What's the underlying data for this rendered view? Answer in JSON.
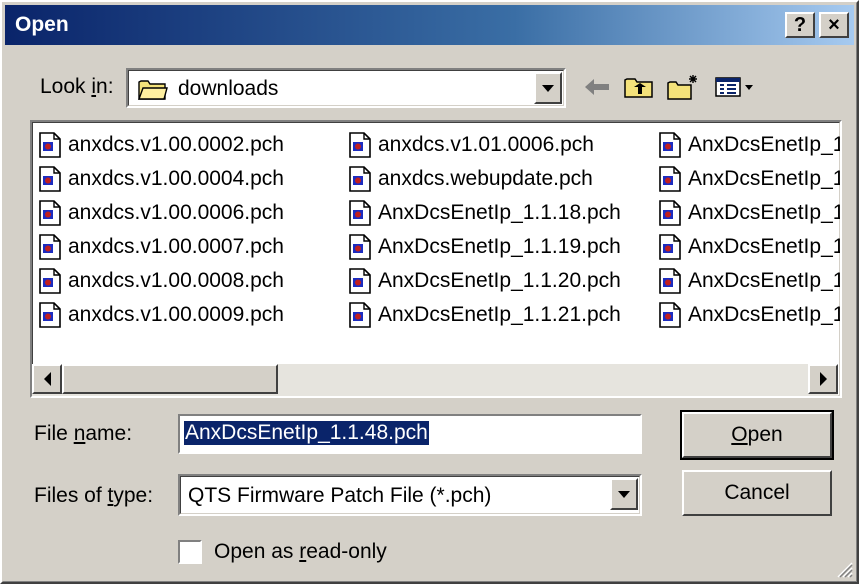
{
  "window": {
    "title": "Open",
    "help_button": "?",
    "close_button": "×"
  },
  "lookin": {
    "label_pre": "Look ",
    "label_key": "i",
    "label_post": "n:",
    "value": "downloads",
    "folder_icon": "folder-icon"
  },
  "toolbar": {
    "back_icon": "back-arrow-icon",
    "up_icon": "up-folder-icon",
    "new_folder_icon": "new-folder-icon",
    "view_menu_icon": "view-menu-icon"
  },
  "files": {
    "col1": [
      "anxdcs.v1.00.0002.pch",
      "anxdcs.v1.00.0004.pch",
      "anxdcs.v1.00.0006.pch",
      "anxdcs.v1.00.0007.pch",
      "anxdcs.v1.00.0008.pch",
      "anxdcs.v1.00.0009.pch"
    ],
    "col2": [
      "anxdcs.v1.01.0006.pch",
      "anxdcs.webupdate.pch",
      "AnxDcsEnetIp_1.1.18.pch",
      "AnxDcsEnetIp_1.1.19.pch",
      "AnxDcsEnetIp_1.1.20.pch",
      "AnxDcsEnetIp_1.1.21.pch"
    ],
    "col3": [
      "AnxDcsEnetIp_1",
      "AnxDcsEnetIp_1",
      "AnxDcsEnetIp_1",
      "AnxDcsEnetIp_1",
      "AnxDcsEnetIp_1",
      "AnxDcsEnetIp_1"
    ]
  },
  "filename": {
    "label_pre": "File ",
    "label_key": "n",
    "label_post": "ame:",
    "value": "AnxDcsEnetIp_1.1.48.pch"
  },
  "filetype": {
    "label_pre": "Files of ",
    "label_key": "t",
    "label_post": "ype:",
    "value": "QTS Firmware Patch File (*.pch)"
  },
  "buttons": {
    "open_key": "O",
    "open_rest": "pen",
    "cancel": "Cancel"
  },
  "readonly": {
    "label_pre": "Open as ",
    "label_key": "r",
    "label_post": "ead-only",
    "checked": false
  },
  "colors": {
    "title_bar": "#0a246a",
    "face": "#d4d0c8",
    "selection": "#0a246a"
  }
}
